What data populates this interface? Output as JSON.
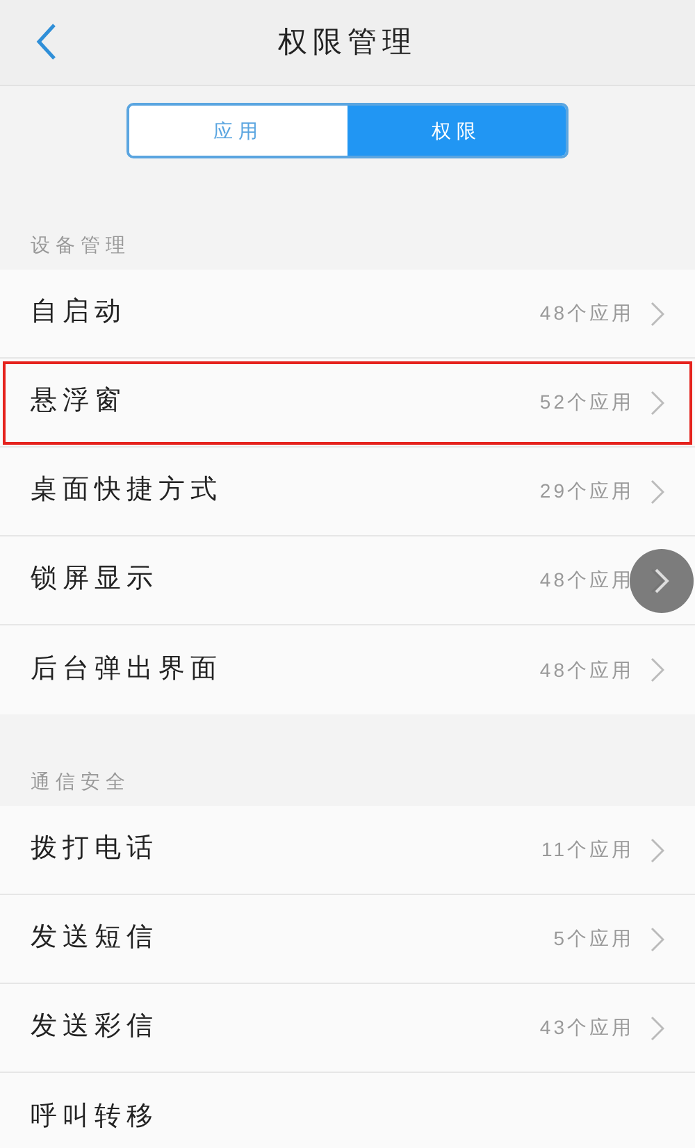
{
  "header": {
    "title": "权限管理"
  },
  "tabs": [
    {
      "label": "应用",
      "selected": false
    },
    {
      "label": "权限",
      "selected": true
    }
  ],
  "sections": [
    {
      "title": "设备管理",
      "rows": [
        {
          "label": "自启动",
          "count": "48个应用",
          "highlighted": false,
          "floating_button": false
        },
        {
          "label": "悬浮窗",
          "count": "52个应用",
          "highlighted": true,
          "floating_button": false
        },
        {
          "label": "桌面快捷方式",
          "count": "29个应用",
          "highlighted": false,
          "floating_button": false
        },
        {
          "label": "锁屏显示",
          "count": "48个应用",
          "highlighted": false,
          "floating_button": true
        },
        {
          "label": "后台弹出界面",
          "count": "48个应用",
          "highlighted": false,
          "floating_button": false
        }
      ]
    },
    {
      "title": "通信安全",
      "rows": [
        {
          "label": "拨打电话",
          "count": "11个应用",
          "highlighted": false,
          "floating_button": false
        },
        {
          "label": "发送短信",
          "count": "5个应用",
          "highlighted": false,
          "floating_button": false
        },
        {
          "label": "发送彩信",
          "count": "43个应用",
          "highlighted": false,
          "floating_button": false
        },
        {
          "label": "呼叫转移",
          "highlighted": false,
          "floating_button": false
        }
      ]
    }
  ]
}
